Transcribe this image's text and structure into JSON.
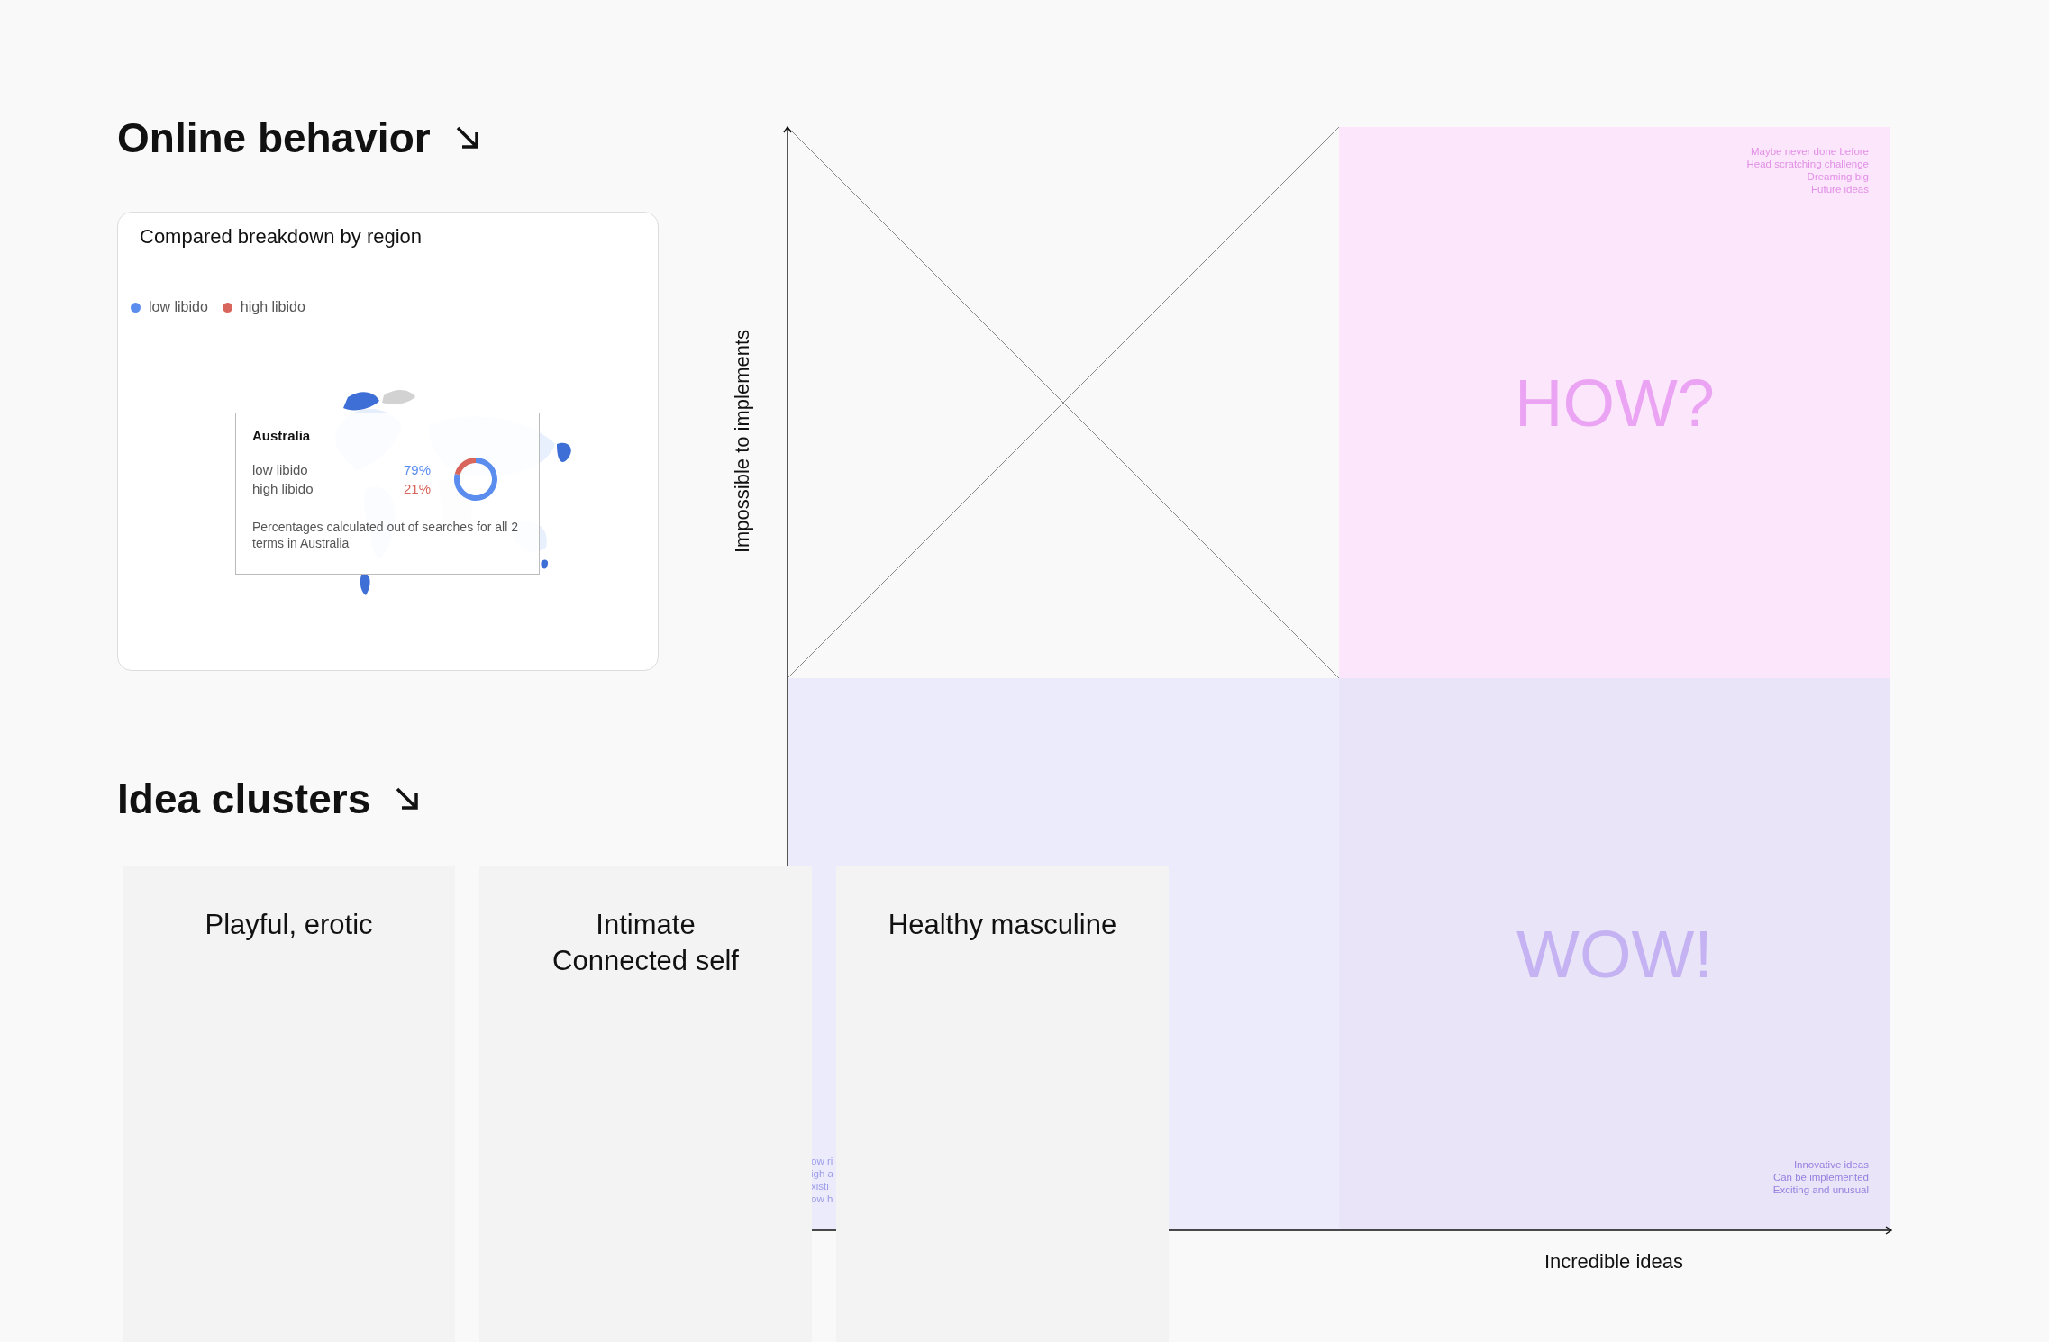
{
  "online_behavior": {
    "heading": "Online behavior",
    "card": {
      "title": "Compared breakdown by region",
      "legend": [
        {
          "label": "low libido",
          "color": "#5b8def"
        },
        {
          "label": "high libido",
          "color": "#d8665c"
        }
      ],
      "tooltip": {
        "region": "Australia",
        "rows": [
          {
            "value": "79%"
          },
          {
            "value": "21%"
          }
        ],
        "chart_data": {
          "type": "donut",
          "categories": [
            "low libido",
            "high libido"
          ],
          "values": [
            79,
            21
          ]
        },
        "note": "Percentages calculated out of searches for all 2 terms in Australia"
      }
    }
  },
  "matrix": {
    "y_axis_label": "Impossible to implements",
    "x_axis_label": "Incredible ideas",
    "quadrants": [
      {
        "kind": "crossed"
      },
      {
        "kind": "titled",
        "color": "#fbe6fb",
        "title": {
          "text": "HOW?",
          "color": "#eba3f3"
        },
        "notes": {
          "kind": "top",
          "color": "#e28fe6",
          "lines": [
            "Maybe never done before",
            "Head scratching challenge",
            "Dreaming big",
            "Future ideas"
          ]
        }
      },
      {
        "kind": "plain",
        "color": "#ebebfb",
        "notes": {
          "kind": "cut",
          "color": "#9d9de8",
          "lines": [
            "ow ri",
            "igh a",
            "xisti",
            "ow h"
          ]
        }
      },
      {
        "kind": "titled",
        "color": "#e9e4f7",
        "title": {
          "text": "WOW!",
          "color": "#c4b2f2"
        },
        "notes": {
          "kind": "bottom",
          "color": "#9780e0",
          "lines": [
            "Innovative ideas",
            "Can be implemented",
            "Exciting and unusual"
          ]
        }
      }
    ]
  },
  "idea_clusters": {
    "heading": "Idea clusters",
    "cards": [
      {
        "label": "Playful, erotic"
      },
      {
        "label": "Intimate\nConnected self"
      },
      {
        "label": "Healthy masculine"
      }
    ]
  }
}
